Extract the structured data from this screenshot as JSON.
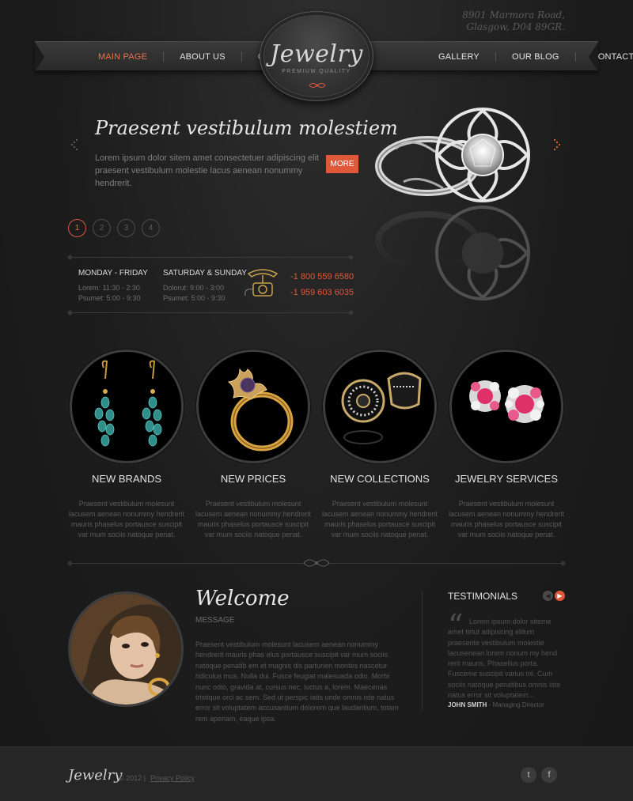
{
  "header": {
    "address_line1": "8901 Marmora Road,",
    "address_line2": "Glasgow, D04 89GR.",
    "logo": "Jewelry",
    "logo_tagline": "Premium Quality"
  },
  "nav": {
    "left": [
      {
        "label": "Main Page",
        "active": true
      },
      {
        "label": "About Us",
        "active": false
      },
      {
        "label": "Collections",
        "active": false
      }
    ],
    "right": [
      {
        "label": "Gallery",
        "active": false
      },
      {
        "label": "Our Blog",
        "active": false
      },
      {
        "label": "Contact Us",
        "active": false
      }
    ]
  },
  "hero": {
    "title": "Praesent vestibulum molestiem",
    "text": "Lorem ipsum dolor sitem amet consectetuer adipiscing elit praesent vestibulum molestie lacus aenean nonummy hendrerit.",
    "more_label": "More",
    "pager": [
      "1",
      "2",
      "3",
      "4"
    ],
    "active_slide": 1
  },
  "schedule": {
    "weekday_title": "Monday - Friday",
    "weekday_line1": "Lorem: 11:30 - 2:30",
    "weekday_line2": "Psumet: 5:00 - 9:30",
    "weekend_title": "Saturday & Sunday",
    "weekend_line1": "Dolorut: 9:00 - 3:00",
    "weekend_line2": "Psumet: 5:00 - 9:30",
    "phone1": "-1 800 559 6580",
    "phone2": "-1 959 603 6035"
  },
  "features": [
    {
      "title": "New Brands",
      "text": "Praesent vestibulum molesunt lacusem aenean nonummy hendrerit mauris phaselus portausce suscipit var mum sociis natoque penat."
    },
    {
      "title": "New Prices",
      "text": "Praesent vestibulum molesunt lacusem aenean nonummy hendrerit mauris phaselus portausce suscipit var mum sociis natoque penat."
    },
    {
      "title": "New Collections",
      "text": "Praesent vestibulum molesunt lacusem aenean nonummy hendrerit mauris phaselus portausce suscipit var mum sociis natoque penat."
    },
    {
      "title": "Jewelry Services",
      "text": "Praesent vestibulum molesunt lacusem aenean nonummy hendrerit mauris phaselus portausce suscipit var mum sociis natoque penat."
    }
  ],
  "welcome": {
    "title": "Welcome",
    "subtitle": "Message",
    "text": "Praesent vestibulum molesunt lacusem aenean nonummy hendrerit mauris phas elus portausce suscipit var mum sociis natoque penatib em et magnis dis parturien montes nascetur ridiculus mus. Nulla dui. Fusce feugiat malesuada odio. Morbi nunc odio, gravida at, cursus nec, luctus a, lorem. Maecenas tristique orci ac sem. Sed ut perspic iatis unde omnis iste natus error sit voluptatem accusantium dolorem que laudantium, totam rem aperiam, eaque ipsa."
  },
  "testimonials": {
    "title": "Testimonials",
    "quote": "Lorem ipsum dolor siteme amet tetut adipiscing elitum praesente vestibulum molestie lacusenean lorem nonum my hend rerit mauris. Phasellus porta. Fusceme suscipit varius mi. Cum sociis natoque penatibus omnis iste natus error sit voluptatem...",
    "author_name": "John Smith",
    "author_role": " - Managing Director"
  },
  "footer": {
    "logo": "Jewelry",
    "copyright": "© 2012  |",
    "privacy": "Privacy Policy",
    "twitter": "t",
    "facebook": "f"
  },
  "colors": {
    "accent": "#e0583a",
    "background": "#1d1d1d",
    "heading": "#e2e2e2"
  },
  "icons": [
    "arrow-left-icon",
    "arrow-right-icon",
    "telephone-icon",
    "quote-icon",
    "twitter-icon",
    "facebook-icon"
  ]
}
